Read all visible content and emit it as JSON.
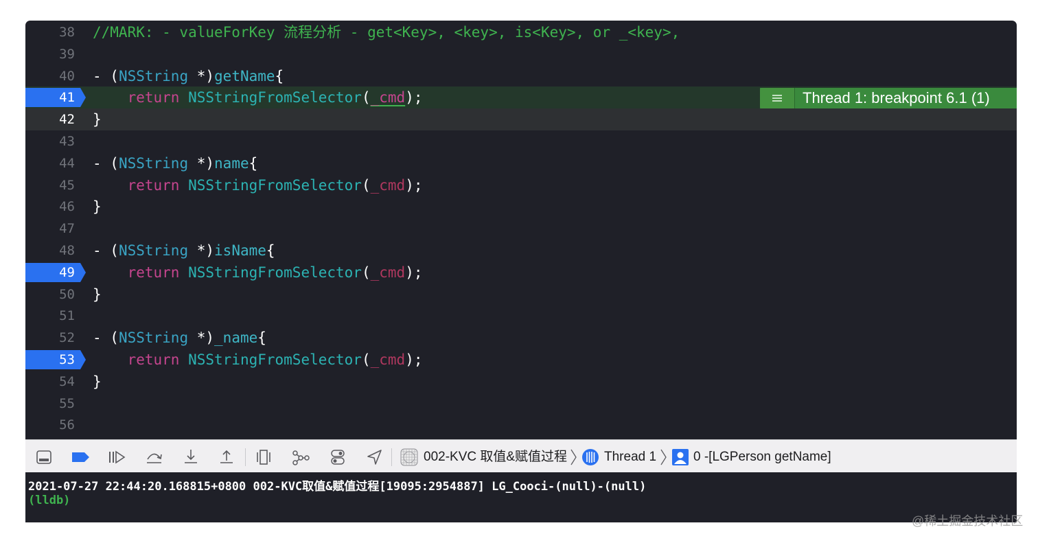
{
  "editor": {
    "lines": [
      {
        "num": "38",
        "seg": [
          [
            "cm",
            "//MARK: - valueForKey 流程分析 - get<Key>, <key>, is<Key>, or _<key>,"
          ]
        ]
      },
      {
        "num": "39",
        "seg": []
      },
      {
        "num": "40",
        "seg": [
          [
            "",
            "- ("
          ],
          [
            "ty",
            "NSString"
          ],
          [
            "",
            " *)"
          ],
          [
            "mt",
            "getName"
          ],
          [
            "",
            "{"
          ]
        ]
      },
      {
        "num": "41",
        "seg": [
          [
            "",
            "    "
          ],
          [
            "kw",
            "return"
          ],
          [
            "",
            " "
          ],
          [
            "fn",
            "NSStringFromSelector"
          ],
          [
            "",
            "("
          ],
          [
            "hl",
            "_cmd"
          ],
          [
            "",
            ");"
          ]
        ]
      },
      {
        "num": "42",
        "seg": [
          [
            "",
            "}"
          ]
        ]
      },
      {
        "num": "43",
        "seg": []
      },
      {
        "num": "44",
        "seg": [
          [
            "",
            "- ("
          ],
          [
            "ty",
            "NSString"
          ],
          [
            "",
            " *)"
          ],
          [
            "mt",
            "name"
          ],
          [
            "",
            "{"
          ]
        ]
      },
      {
        "num": "45",
        "seg": [
          [
            "",
            "    "
          ],
          [
            "kw",
            "return"
          ],
          [
            "",
            " "
          ],
          [
            "fn",
            "NSStringFromSelector"
          ],
          [
            "",
            "("
          ],
          [
            "pv",
            "_cmd"
          ],
          [
            "",
            ");"
          ]
        ]
      },
      {
        "num": "46",
        "seg": [
          [
            "",
            "}"
          ]
        ]
      },
      {
        "num": "47",
        "seg": []
      },
      {
        "num": "48",
        "seg": [
          [
            "",
            "- ("
          ],
          [
            "ty",
            "NSString"
          ],
          [
            "",
            " *)"
          ],
          [
            "mt",
            "isName"
          ],
          [
            "",
            "{"
          ]
        ]
      },
      {
        "num": "49",
        "seg": [
          [
            "",
            "    "
          ],
          [
            "kw",
            "return"
          ],
          [
            "",
            " "
          ],
          [
            "fn",
            "NSStringFromSelector"
          ],
          [
            "",
            "("
          ],
          [
            "pv",
            "_cmd"
          ],
          [
            "",
            ");"
          ]
        ]
      },
      {
        "num": "50",
        "seg": [
          [
            "",
            "}"
          ]
        ]
      },
      {
        "num": "51",
        "seg": []
      },
      {
        "num": "52",
        "seg": [
          [
            "",
            "- ("
          ],
          [
            "ty",
            "NSString"
          ],
          [
            "",
            " *)"
          ],
          [
            "mt",
            "_name"
          ],
          [
            "",
            "{"
          ]
        ]
      },
      {
        "num": "53",
        "seg": [
          [
            "",
            "    "
          ],
          [
            "kw",
            "return"
          ],
          [
            "",
            " "
          ],
          [
            "fn",
            "NSStringFromSelector"
          ],
          [
            "",
            "("
          ],
          [
            "pv",
            "_cmd"
          ],
          [
            "",
            ");"
          ]
        ]
      },
      {
        "num": "54",
        "seg": [
          [
            "",
            "}"
          ]
        ]
      },
      {
        "num": "55",
        "seg": []
      },
      {
        "num": "56",
        "seg": []
      }
    ],
    "breakpoint_lines": [
      "41",
      "49",
      "53"
    ],
    "current_line": "42",
    "hit_line": "41",
    "breakpoint_annotation": "Thread 1: breakpoint 6.1 (1)"
  },
  "debug_bar": {
    "buttons": [
      {
        "name": "hide-console-button",
        "icon": "console-panel-icon"
      },
      {
        "name": "breakpoints-toggle-button",
        "icon": "breakpoint-icon"
      },
      {
        "name": "continue-button",
        "icon": "continue-icon"
      },
      {
        "name": "step-over-button",
        "icon": "step-over-icon"
      },
      {
        "name": "step-into-button",
        "icon": "step-into-icon"
      },
      {
        "name": "step-out-button",
        "icon": "step-out-icon"
      },
      {
        "name": "view-debugger-button",
        "icon": "view-hierarchy-icon"
      },
      {
        "name": "memory-graph-button",
        "icon": "memory-graph-icon"
      },
      {
        "name": "environment-overrides-button",
        "icon": "toggles-icon"
      },
      {
        "name": "simulate-location-button",
        "icon": "location-arrow-icon"
      }
    ],
    "breadcrumbs": {
      "project": "002-KVC 取值&赋值过程",
      "thread": "Thread 1",
      "frame": "0 -[LGPerson getName]"
    }
  },
  "console": {
    "output": "2021-07-27 22:44:20.168815+0800 002-KVC取值&赋值过程[19095:2954887] LG_Cooci-(null)-(null)",
    "prompt": "(lldb)"
  },
  "watermark": "@稀土掘金技术社区",
  "colors": {
    "editor_bg": "#1f2028",
    "comment": "#3fb34f",
    "keyword": "#c5458e",
    "type": "#3aa4c4",
    "breakpoint": "#2a71f0",
    "breakpoint_annotation_bg": "#3a8a3d"
  }
}
